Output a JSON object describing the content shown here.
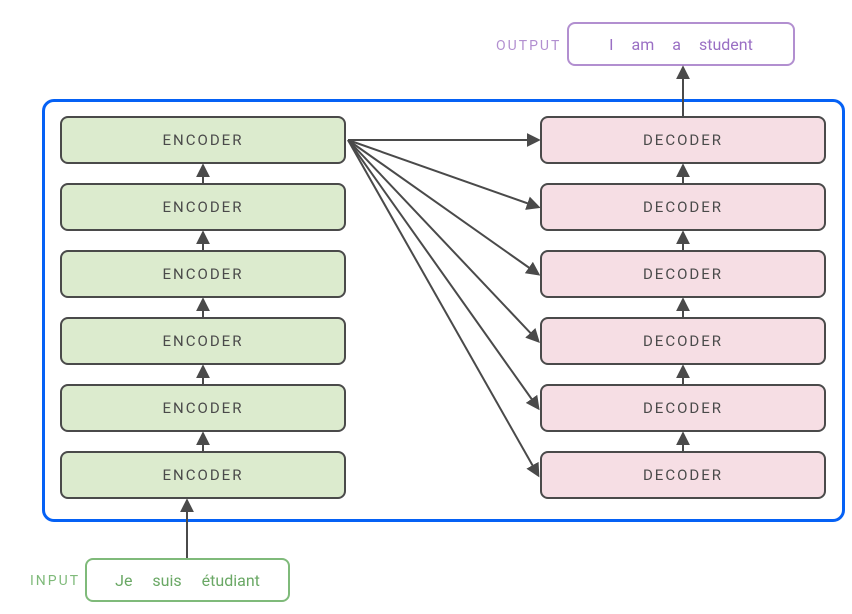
{
  "output": {
    "label": "OUTPUT",
    "tokens": [
      "I",
      "am",
      "a",
      "student"
    ]
  },
  "input": {
    "label": "INPUT",
    "tokens": [
      "Je",
      "suis",
      "étudiant"
    ]
  },
  "encoder": {
    "label": "ENCODER",
    "count": 6
  },
  "decoder": {
    "label": "DECODER",
    "count": 6
  },
  "colors": {
    "encoder_fill": "#dcebce",
    "decoder_fill": "#f6dee4",
    "main_border": "#0561f5",
    "output_accent": "#b28fd0",
    "input_accent": "#7fba7a",
    "arrow": "#4a4a4a"
  }
}
